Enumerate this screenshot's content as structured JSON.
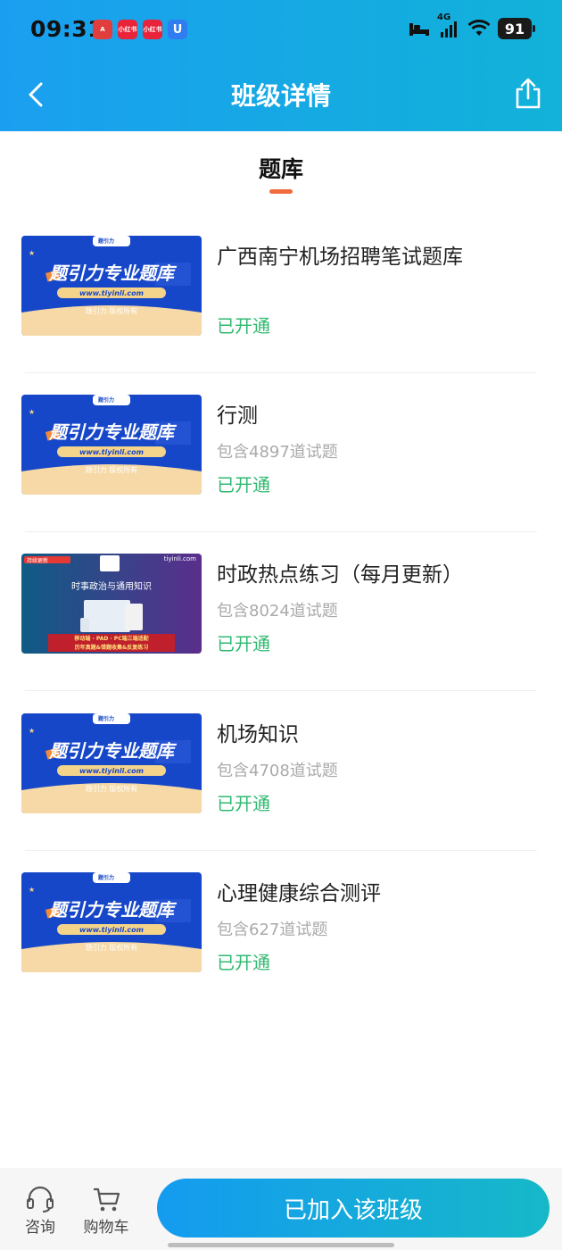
{
  "status_bar": {
    "time": "09:31",
    "battery": "91",
    "network": "4G",
    "notifications": [
      {
        "icon": "app-a-icon",
        "text": "A",
        "color": "#e23d3d"
      },
      {
        "icon": "xiaohongshu-icon",
        "text": "小红书",
        "color": "#e8233a"
      },
      {
        "icon": "xiaohongshu-icon-2",
        "text": "小红书",
        "color": "#e8233a"
      },
      {
        "icon": "u-app-icon",
        "text": "U",
        "color": "#2f7df0"
      }
    ]
  },
  "nav": {
    "title": "班级详情",
    "back_icon": "chevron-left-icon",
    "share_icon": "share-icon"
  },
  "section": {
    "tab_label": "题库",
    "accent": "#f06b3d"
  },
  "thumb_text": {
    "main": "题引力专业题库",
    "url": "www.tiyinli.com",
    "copyright": "题引力 版权所有",
    "brand": "题引力",
    "alt_badge": "持续更新",
    "alt_site": "tiyinli.com",
    "alt_main": "时事政治与通用知识",
    "alt_line1": "移动端 · PAD · PC端三端适配",
    "alt_line2": "历年真题&错题收集&反复练习"
  },
  "items": [
    {
      "title": "广西南宁机场招聘笔试题库",
      "count": "",
      "status": "已开通",
      "thumb": "blue"
    },
    {
      "title": "行测",
      "count": "包含4897道试题",
      "status": "已开通",
      "thumb": "blue"
    },
    {
      "title": "时政热点练习（每月更新）",
      "count": "包含8024道试题",
      "status": "已开通",
      "thumb": "purple"
    },
    {
      "title": "机场知识",
      "count": "包含4708道试题",
      "status": "已开通",
      "thumb": "blue"
    },
    {
      "title": "心理健康综合测评",
      "count": "包含627道试题",
      "status": "已开通",
      "thumb": "blue"
    }
  ],
  "bottom": {
    "consult_label": "咨询",
    "cart_label": "购物车",
    "join_label": "已加入该班级"
  },
  "colors": {
    "header_start": "#1a9ff0",
    "header_end": "#12b2d9",
    "status_green": "#2fb970"
  }
}
